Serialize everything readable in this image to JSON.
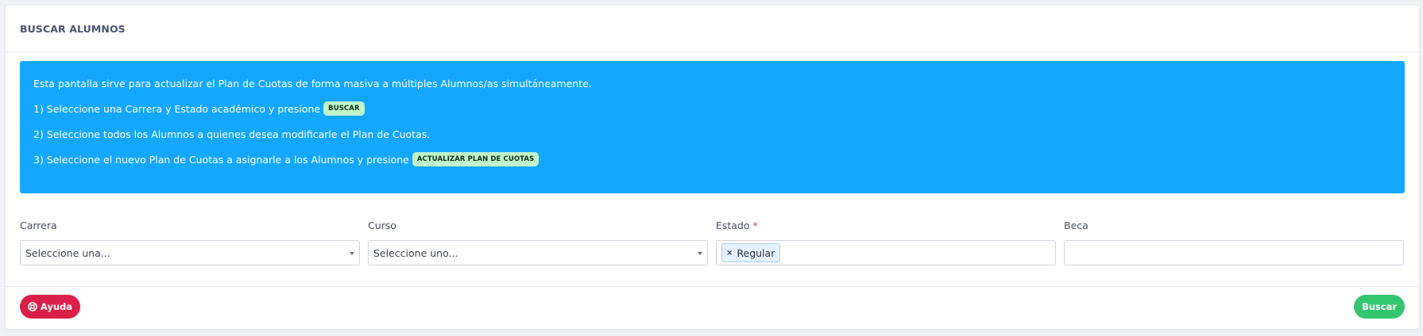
{
  "card": {
    "title": "BUSCAR ALUMNOS"
  },
  "info": {
    "line1": "Esta pantalla sirve para actualizar el Plan de Cuotas de forma masiva a múltiples Alumnos/as simultáneamente.",
    "line2": "1) Seleccione una Carrera y Estado académico y presione",
    "line2_badge": "BUSCAR",
    "line3": "2) Seleccione todos los Alumnos a quienes desea modificarle el Plan de Cuotas.",
    "line4": "3) Seleccione el nuevo Plan de Cuotas a asignarle a los Alumnos y presione",
    "line4_badge": "ACTUALIZAR PLAN DE CUOTAS",
    "bg_color": "#14a7ff"
  },
  "fields": {
    "carrera": {
      "label": "Carrera",
      "value": "Seleccione una..."
    },
    "curso": {
      "label": "Curso",
      "value": "Seleccione uno..."
    },
    "estado": {
      "label": "Estado",
      "required_mark": "*",
      "tags": [
        "Regular"
      ],
      "remove_glyph": "×"
    },
    "beca": {
      "label": "Beca",
      "value": ""
    }
  },
  "footer": {
    "help_label": "Ayuda",
    "help_icon": "lifebuoy-icon",
    "search_label": "Buscar",
    "help_color": "#dc1f4a",
    "search_color": "#34c56f"
  }
}
